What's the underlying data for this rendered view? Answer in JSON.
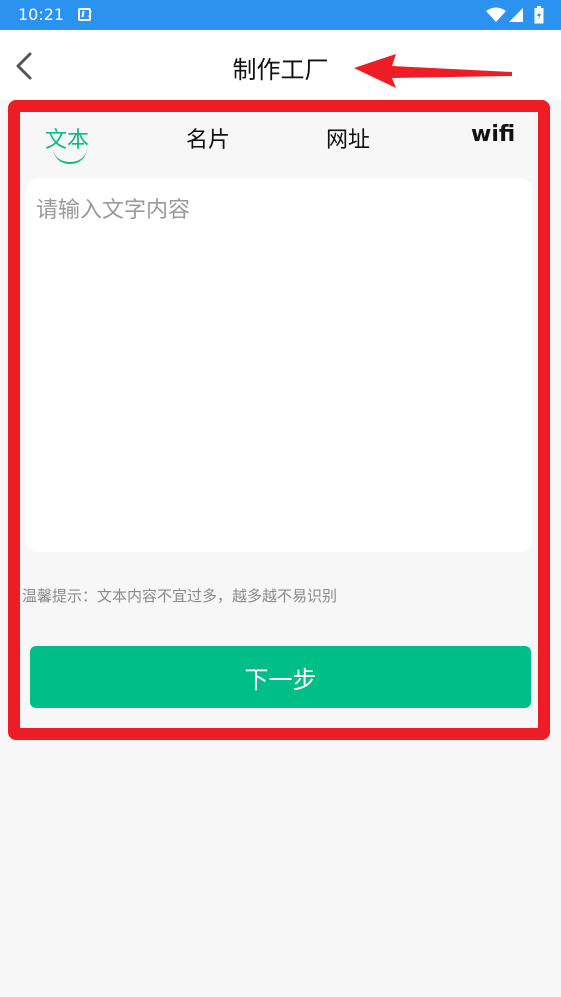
{
  "status_bar": {
    "time": "10:21"
  },
  "header": {
    "title": "制作工厂",
    "back_icon": "chevron-left-icon"
  },
  "tabs": [
    {
      "label": "文本",
      "active": true
    },
    {
      "label": "名片",
      "active": false
    },
    {
      "label": "网址",
      "active": false
    },
    {
      "label": "wifi",
      "active": false
    }
  ],
  "text_input": {
    "placeholder": "请输入文字内容",
    "value": ""
  },
  "tip": "温馨提示：文本内容不宜过多，越多越不易识别",
  "next_button": "下一步",
  "colors": {
    "status_bar": "#2b92ef",
    "accent": "#0fba85",
    "button": "#00be88",
    "highlight": "#ee1c25"
  }
}
